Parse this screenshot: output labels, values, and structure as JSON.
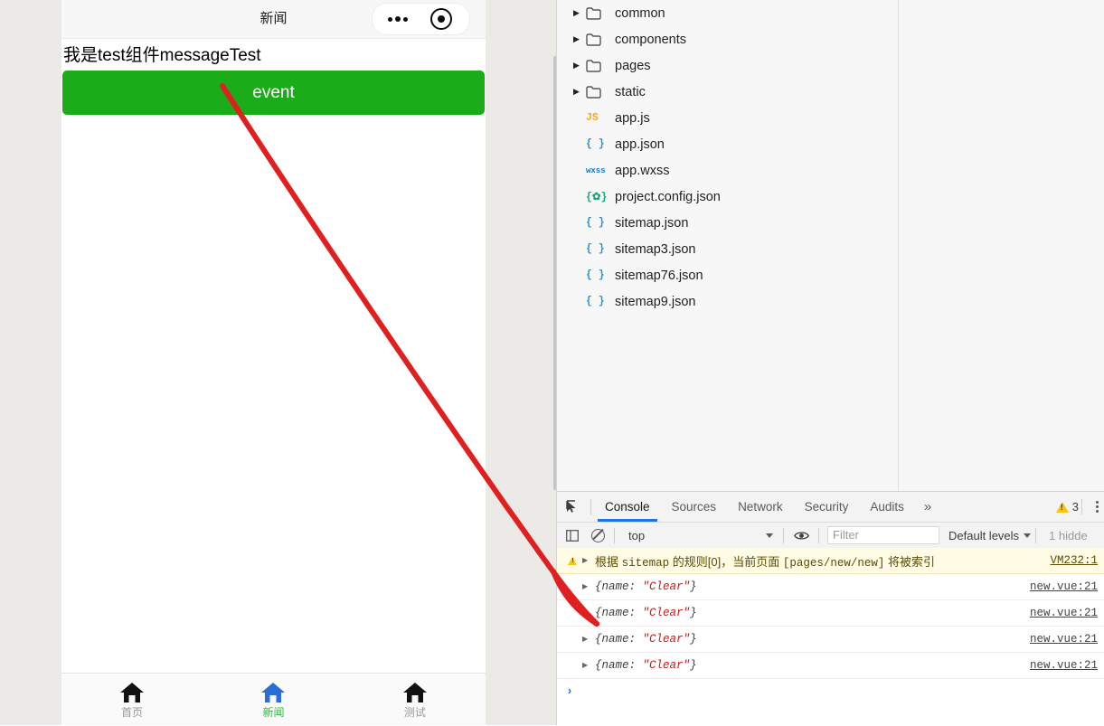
{
  "simulator": {
    "navbar": {
      "title": "新闻",
      "capsule": {
        "menu_icon": "three-dots-icon",
        "target_icon": "target-circle-icon"
      }
    },
    "body": {
      "message_text": "我是test组件messageTest",
      "event_button_label": "event",
      "event_button_color": "#1aad19"
    },
    "tabbar": {
      "items": [
        {
          "label": "首页",
          "icon": "home-icon",
          "active": false,
          "color": "#999999",
          "icon_color": "#1a1a1a"
        },
        {
          "label": "新闻",
          "icon": "home-icon",
          "active": true,
          "color": "#39b54a",
          "icon_color": "#2b6fd6"
        },
        {
          "label": "测试",
          "icon": "home-icon",
          "active": false,
          "color": "#999999",
          "icon_color": "#1a1a1a"
        }
      ]
    }
  },
  "file_tree": {
    "rows": [
      {
        "name": "common",
        "type": "folder",
        "expandable": true,
        "badge": ""
      },
      {
        "name": "components",
        "type": "folder",
        "expandable": true,
        "badge": ""
      },
      {
        "name": "pages",
        "type": "folder",
        "expandable": true,
        "badge": ""
      },
      {
        "name": "static",
        "type": "folder",
        "expandable": true,
        "badge": ""
      },
      {
        "name": "app.js",
        "type": "js",
        "expandable": false,
        "badge": "JS"
      },
      {
        "name": "app.json",
        "type": "json",
        "expandable": false,
        "badge": "{ }"
      },
      {
        "name": "app.wxss",
        "type": "wxss",
        "expandable": false,
        "badge": "wxss"
      },
      {
        "name": "project.config.json",
        "type": "config",
        "expandable": false,
        "badge": "{✿}"
      },
      {
        "name": "sitemap.json",
        "type": "json",
        "expandable": false,
        "badge": "{ }"
      },
      {
        "name": "sitemap3.json",
        "type": "json",
        "expandable": false,
        "badge": "{ }"
      },
      {
        "name": "sitemap76.json",
        "type": "json",
        "expandable": false,
        "badge": "{ }"
      },
      {
        "name": "sitemap9.json",
        "type": "json",
        "expandable": false,
        "badge": "{ }"
      }
    ]
  },
  "devtools": {
    "tabs": [
      {
        "label": "Console",
        "active": true
      },
      {
        "label": "Sources",
        "active": false
      },
      {
        "label": "Network",
        "active": false
      },
      {
        "label": "Security",
        "active": false
      },
      {
        "label": "Audits",
        "active": false
      }
    ],
    "overflow_label": "»",
    "warning_count": "3",
    "inspect_icon": "inspect-element-icon",
    "kebab_icon": "more-vertical-icon",
    "filterbar": {
      "sidebar_toggle_icon": "console-sidebar-icon",
      "clear_icon": "clear-console-icon",
      "context": "top",
      "eye_icon": "live-expression-icon",
      "filter_placeholder": "Filter",
      "filter_value": "",
      "levels_label": "Default levels",
      "hidden_note": "1 hidde"
    },
    "messages": [
      {
        "kind": "warning",
        "prefix": "根据 ",
        "mono1": "sitemap",
        "mid": " 的规则[0]，当前页面 ",
        "mono2": "[pages/new/new]",
        "suffix": " 将被索引",
        "source": "VM232:1"
      },
      {
        "kind": "object",
        "key": "{name: ",
        "value": "\"Clear\"",
        "close": "}",
        "source": "new.vue:21"
      },
      {
        "kind": "object",
        "key": "{name: ",
        "value": "\"Clear\"",
        "close": "}",
        "source": "new.vue:21"
      },
      {
        "kind": "object",
        "key": "{name: ",
        "value": "\"Clear\"",
        "close": "}",
        "source": "new.vue:21"
      },
      {
        "kind": "object",
        "key": "{name: ",
        "value": "\"Clear\"",
        "close": "}",
        "source": "new.vue:21"
      }
    ],
    "prompt_chevron": "›"
  },
  "annotation": {
    "arrow_color": "#e02020",
    "description": "red-arrow-from-event-button-to-console-output"
  }
}
